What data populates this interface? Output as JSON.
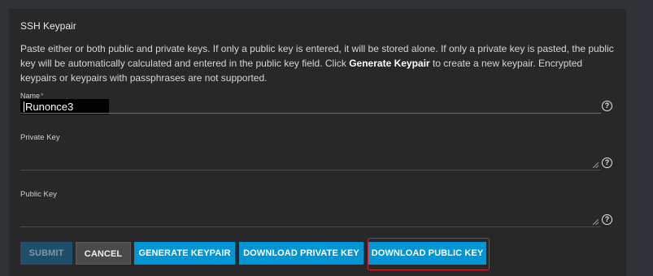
{
  "card": {
    "title": "SSH Keypair",
    "instructions_part1": "Paste either or both public and private keys. If only a public key is entered, it will be stored alone. If only a private key is pasted, the public key will be automatically calculated and entered in the public key field. Click ",
    "instructions_bold": "Generate Keypair",
    "instructions_part2": " to create a new keypair. Encrypted keypairs or keypairs with passphrases are not supported."
  },
  "fields": {
    "name_label": "Name",
    "name_required_mark": "*",
    "name_value": "Runonce3",
    "private_key_label": "Private Key",
    "private_key_value": "",
    "public_key_label": "Public Key",
    "public_key_value": ""
  },
  "icons": {
    "help": "?"
  },
  "buttons": {
    "submit": "SUBMIT",
    "cancel": "CANCEL",
    "generate_keypair": "GENERATE KEYPAIR",
    "download_private_key": "DOWNLOAD PRIVATE KEY",
    "download_public_key": "DOWNLOAD PUBLIC KEY"
  },
  "colors": {
    "primary": "#0095d5",
    "focus_line": "#2b7fb0",
    "highlight_box": "#e0202a"
  }
}
